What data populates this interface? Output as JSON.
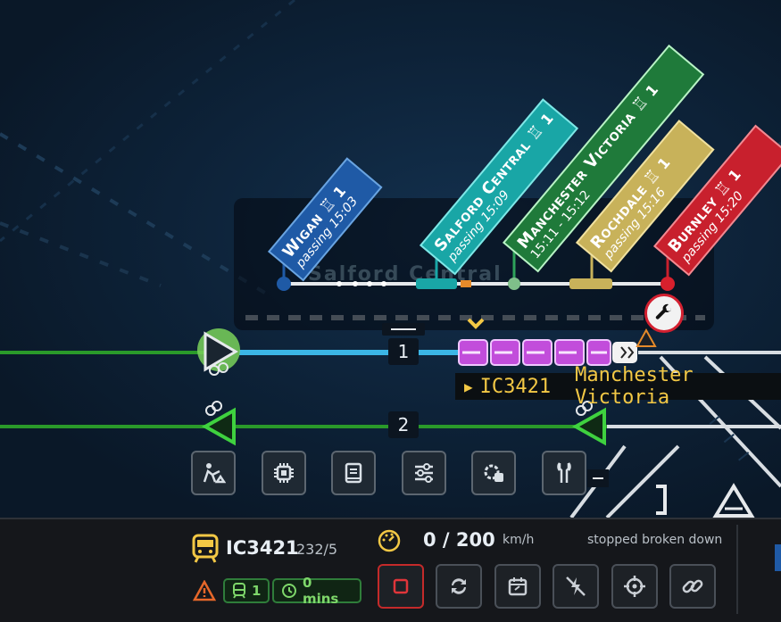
{
  "colors": {
    "wigan": "#1f5aa6",
    "salford": "#19a6a6",
    "manchester": "#1f7a3a",
    "rochdale": "#c8b25a",
    "burnley": "#c8202d",
    "track_blue": "#3bb6e6",
    "track_green": "#2a9a2a",
    "train_magenta": "#c24ddb",
    "accent_yellow": "#f3c845"
  },
  "background_text": "Salford Central",
  "stations": [
    {
      "name": "Wigan",
      "platform": "1",
      "detail": "passing 15:03"
    },
    {
      "name": "Salford Central",
      "platform": "1",
      "detail": "passing 15:09"
    },
    {
      "name": "Manchester Victoria",
      "platform": "1",
      "detail": "15:11 - 15:12"
    },
    {
      "name": "Rochdale",
      "platform": "1",
      "detail": "passing 15:16"
    },
    {
      "name": "Burnley",
      "platform": "1",
      "detail": "passing 15:20"
    }
  ],
  "tracks": [
    {
      "label": "1"
    },
    {
      "label": "2"
    }
  ],
  "train_label": {
    "id": "IC3421",
    "destination": "Manchester Victoria"
  },
  "tools": [
    {
      "icon": "track-work-icon"
    },
    {
      "icon": "chip-icon"
    },
    {
      "icon": "book-icon"
    },
    {
      "icon": "sliders-icon"
    },
    {
      "icon": "puzzle-gear-icon"
    },
    {
      "icon": "wrench-icon"
    }
  ],
  "status_bar": {
    "train_id": "IC3421",
    "train_sub": "232/5",
    "speed": "0 / 200",
    "speed_unit": "km/h",
    "state": "stopped broken down",
    "car_count": "1",
    "delay": "0 mins"
  },
  "actions": [
    {
      "icon": "stop-icon"
    },
    {
      "icon": "reverse-icon"
    },
    {
      "icon": "timetable-icon"
    },
    {
      "icon": "no-power-icon"
    },
    {
      "icon": "target-icon"
    },
    {
      "icon": "link-icon"
    }
  ]
}
